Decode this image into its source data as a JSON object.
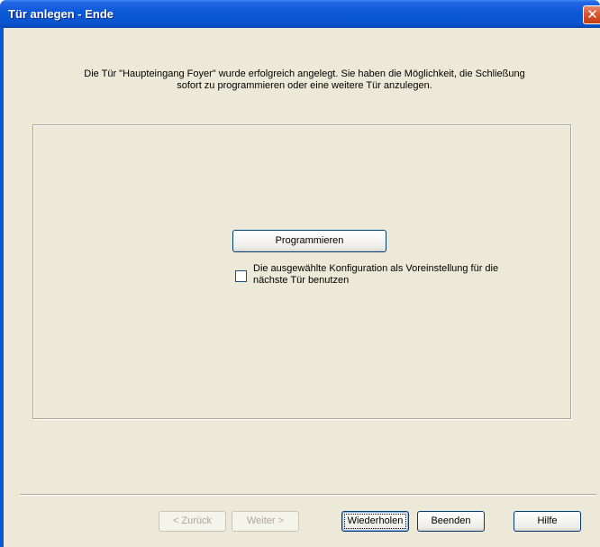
{
  "window": {
    "title": "Tür anlegen - Ende"
  },
  "icons": {
    "close": "close-icon"
  },
  "intro_text": "Die Tür \"Haupteingang Foyer\" wurde erfolgreich angelegt. Sie haben die Möglichkeit, die Schließung\nsofort zu programmieren oder eine weitere Tür anzulegen.",
  "panel": {
    "program_button": "Programmieren",
    "checkbox_label": "Die ausgewählte Konfiguration als Voreinstellung für die\nnächste Tür benutzen",
    "checkbox_checked": false
  },
  "footer": {
    "back": "< Zurück",
    "next": "Weiter >",
    "repeat": "Wiederholen",
    "finish": "Beenden",
    "help": "Hilfe"
  },
  "colors": {
    "titlebar": "#0a58d6",
    "dialog_background": "#ece9d8",
    "close_button": "#d8542c"
  }
}
